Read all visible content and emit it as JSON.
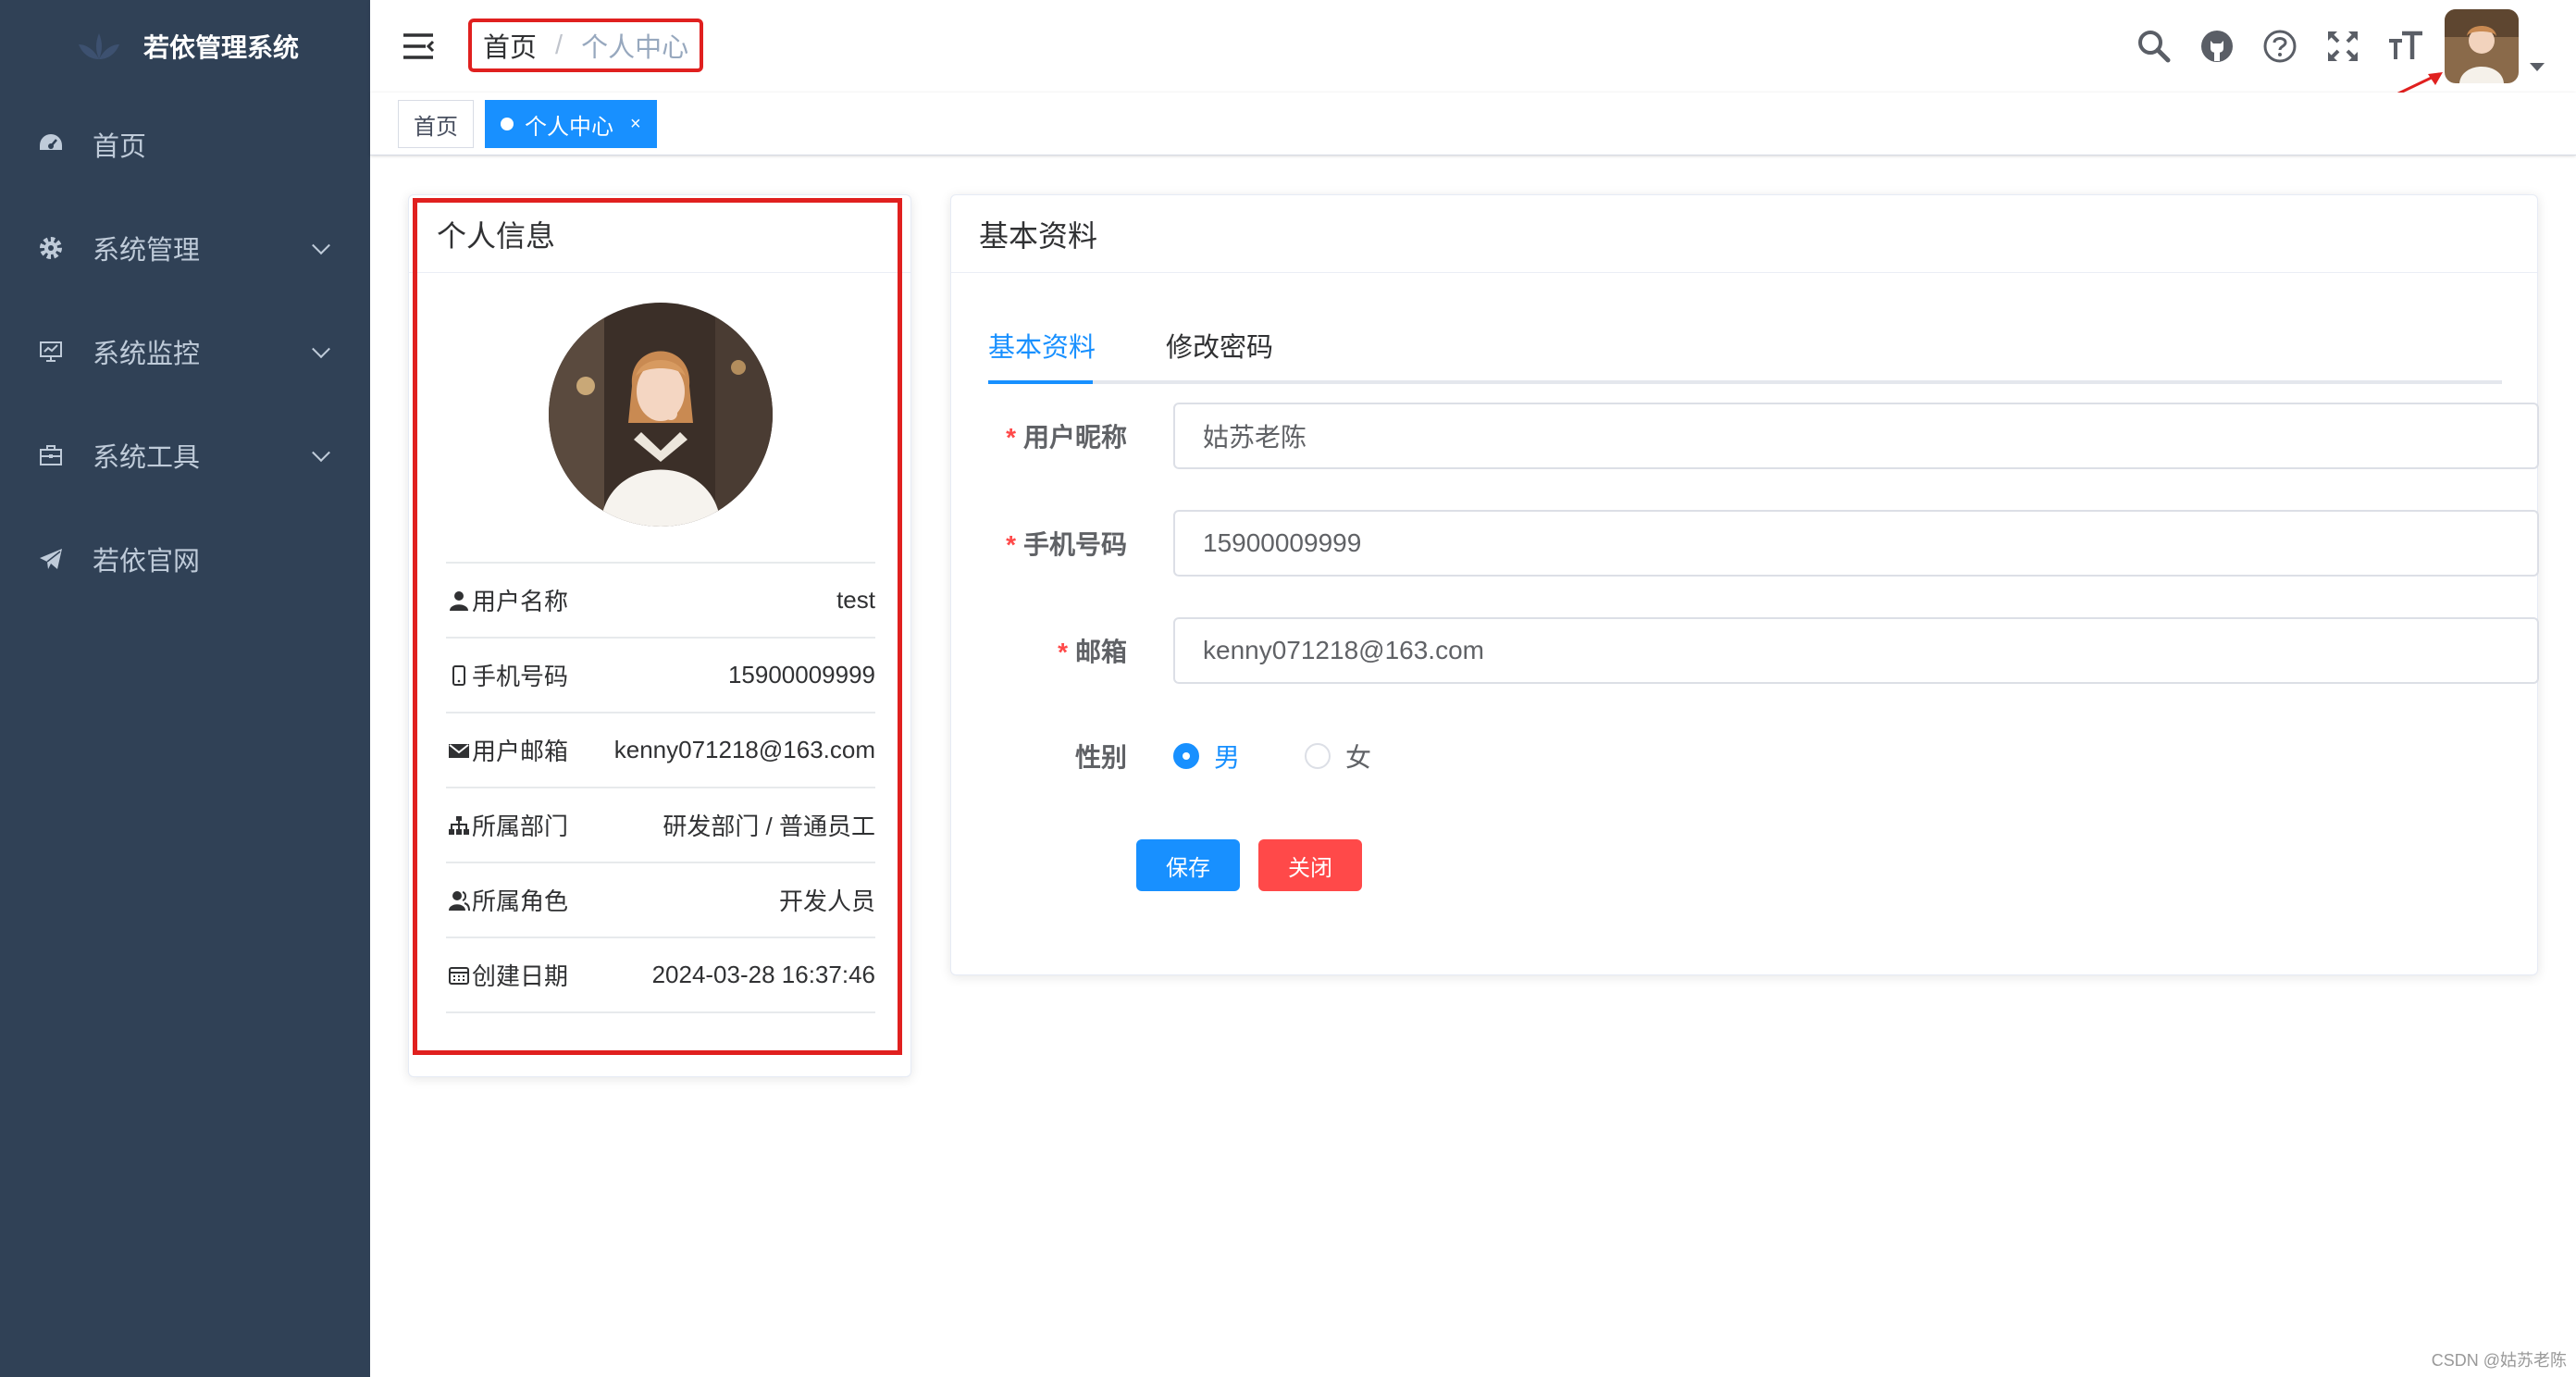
{
  "app": {
    "title": "若依管理系统"
  },
  "sidebar": {
    "items": [
      {
        "label": "首页",
        "icon": "dashboard-icon",
        "has_children": false
      },
      {
        "label": "系统管理",
        "icon": "gear-icon",
        "has_children": true
      },
      {
        "label": "系统监控",
        "icon": "monitor-icon",
        "has_children": true
      },
      {
        "label": "系统工具",
        "icon": "toolbox-icon",
        "has_children": true
      },
      {
        "label": "若依官网",
        "icon": "paper-plane-icon",
        "has_children": false
      }
    ]
  },
  "navbar": {
    "breadcrumb": {
      "home": "首页",
      "separator": "/",
      "current": "个人中心"
    },
    "tools": [
      "search-icon",
      "github-icon",
      "question-icon",
      "fullscreen-icon",
      "font-size-icon"
    ]
  },
  "tagsview": {
    "tags": [
      {
        "label": "首页",
        "active": false
      },
      {
        "label": "个人中心",
        "active": true,
        "close": "×"
      }
    ]
  },
  "profile_card": {
    "title": "个人信息",
    "rows": [
      {
        "label": "用户名称",
        "value": "test",
        "icon": "user-icon"
      },
      {
        "label": "手机号码",
        "value": "15900009999",
        "icon": "phone-icon"
      },
      {
        "label": "用户邮箱",
        "value": "kenny071218@163.com",
        "icon": "email-icon"
      },
      {
        "label": "所属部门",
        "value": "研发部门 / 普通员工",
        "icon": "tree-icon"
      },
      {
        "label": "所属角色",
        "value": "开发人员",
        "icon": "peoples-icon"
      },
      {
        "label": "创建日期",
        "value": "2024-03-28 16:37:46",
        "icon": "date-icon"
      }
    ]
  },
  "basic_card": {
    "title": "基本资料",
    "tabs": [
      {
        "label": "基本资料",
        "active": true
      },
      {
        "label": "修改密码",
        "active": false
      }
    ],
    "form": {
      "nickname": {
        "label": "用户昵称",
        "required": "*",
        "value": "姑苏老陈"
      },
      "phone": {
        "label": "手机号码",
        "required": "*",
        "value": "15900009999"
      },
      "email": {
        "label": "邮箱",
        "required": "*",
        "value": "kenny071218@163.com"
      },
      "gender": {
        "label": "性别",
        "options": [
          "男",
          "女"
        ],
        "selected": "男"
      }
    },
    "buttons": {
      "save": "保存",
      "close": "关闭"
    }
  },
  "colors": {
    "sidebar_bg": "#304156",
    "primary": "#1890ff",
    "danger": "#ff4949",
    "annotation": "#e0201f"
  },
  "watermark": "CSDN @姑苏老陈"
}
